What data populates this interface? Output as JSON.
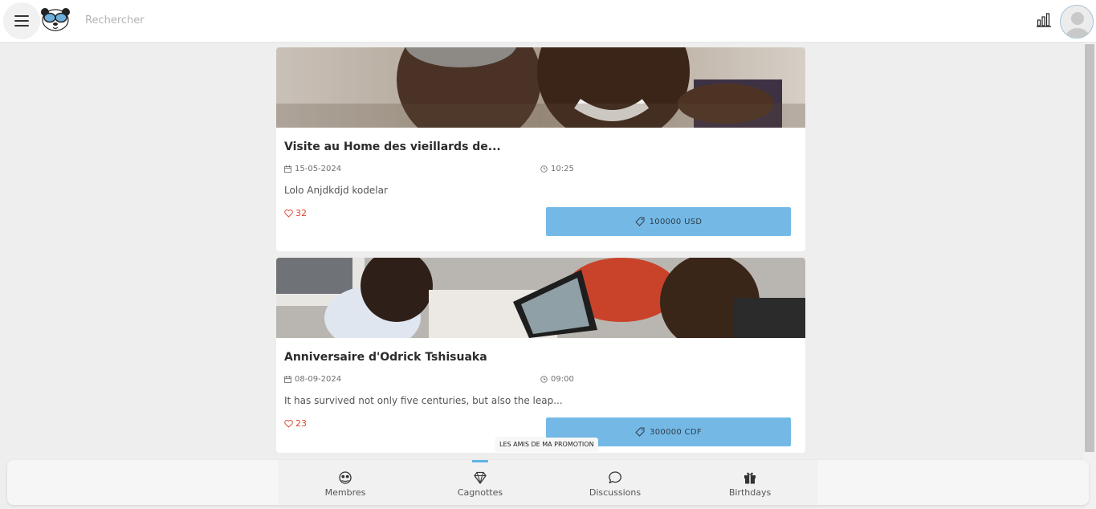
{
  "header": {
    "search_placeholder": "Rechercher"
  },
  "events": [
    {
      "title": "Visite au Home des vieillards de...",
      "date": "15-05-2024",
      "time": "10:25",
      "description": "Lolo Anjdkdjd kodelar",
      "likes": "32",
      "amount": "100000 USD"
    },
    {
      "title": "Anniversaire d'Odrick Tshisuaka",
      "date": "08-09-2024",
      "time": "09:00",
      "description": "It has survived not only five centuries, but also the leap...",
      "likes": "23",
      "amount": "300000 CDF"
    }
  ],
  "tooltip": "LES AMIS DE MA PROMOTION",
  "bottom_nav": {
    "items": [
      {
        "label": "Membres",
        "icon": "members-icon"
      },
      {
        "label": "Cagnottes",
        "icon": "diamond-icon",
        "active": true
      },
      {
        "label": "Discussions",
        "icon": "chat-icon"
      },
      {
        "label": "Birthdays",
        "icon": "gift-icon"
      }
    ]
  },
  "colors": {
    "accent": "#74b9e6",
    "like": "#d9472e",
    "active_indicator": "#5fb3e8"
  }
}
